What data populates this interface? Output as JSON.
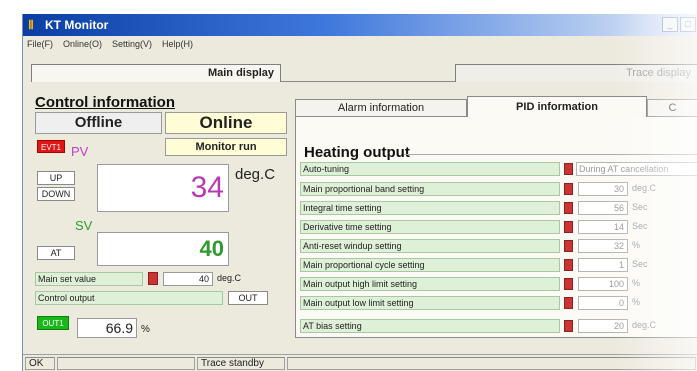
{
  "window": {
    "title": "KT Monitor",
    "app_icon": "kt-logo-icon",
    "min_glyph": "_",
    "max_glyph": "□"
  },
  "menu": [
    "File(F)",
    "Online(O)",
    "Setting(V)",
    "Help(H)"
  ],
  "top_tabs": {
    "active": "Main display",
    "inactive": "Trace display"
  },
  "control": {
    "title": "Control information",
    "status_offline": "Offline",
    "status_online": "Online",
    "evt1": "EVT1",
    "pv_label": "PV",
    "monitor_run": "Monitor run",
    "up": "UP",
    "down": "DOWN",
    "pv_value": "34",
    "pv_unit": "deg.C",
    "sv_label": "SV",
    "at": "AT",
    "sv_value": "40",
    "main_set_value_label": "Main set value",
    "main_set_value": "40",
    "main_set_value_unit": "deg.C",
    "control_output_label": "Control output",
    "out_button": "OUT",
    "out1": "OUT1",
    "output_value": "66.9",
    "output_unit": "%"
  },
  "right_tabs": [
    "Alarm information",
    "PID information",
    "C"
  ],
  "heating": {
    "title": "Heating output",
    "auto_tuning": {
      "label": "Auto-tuning",
      "value": "During AT cancellation"
    },
    "rows": [
      {
        "label": "Main proportional band setting",
        "value": "30",
        "unit": "deg.C"
      },
      {
        "label": "Integral time setting",
        "value": "56",
        "unit": "Sec"
      },
      {
        "label": "Derivative time setting",
        "value": "14",
        "unit": "Sec"
      },
      {
        "label": "Anti-reset windup setting",
        "value": "32",
        "unit": "%"
      },
      {
        "label": "Main proportional cycle setting",
        "value": "1",
        "unit": "Sec"
      },
      {
        "label": "Main output high limit setting",
        "value": "100",
        "unit": "%"
      },
      {
        "label": "Main output low limit setting",
        "value": "0",
        "unit": "%"
      }
    ],
    "at_bias": {
      "label": "AT bias setting",
      "value": "20",
      "unit": "deg.C"
    }
  },
  "statusbar": {
    "cell1": "OK",
    "cell2": "",
    "cell3": "Trace standby",
    "cell4": ""
  },
  "colors": {
    "evt_red": "#e01515",
    "out_green": "#17b817",
    "pv_magenta": "#b53cb5",
    "sv_green": "#2e9b2e",
    "title_blue": "#0a3ea5"
  }
}
